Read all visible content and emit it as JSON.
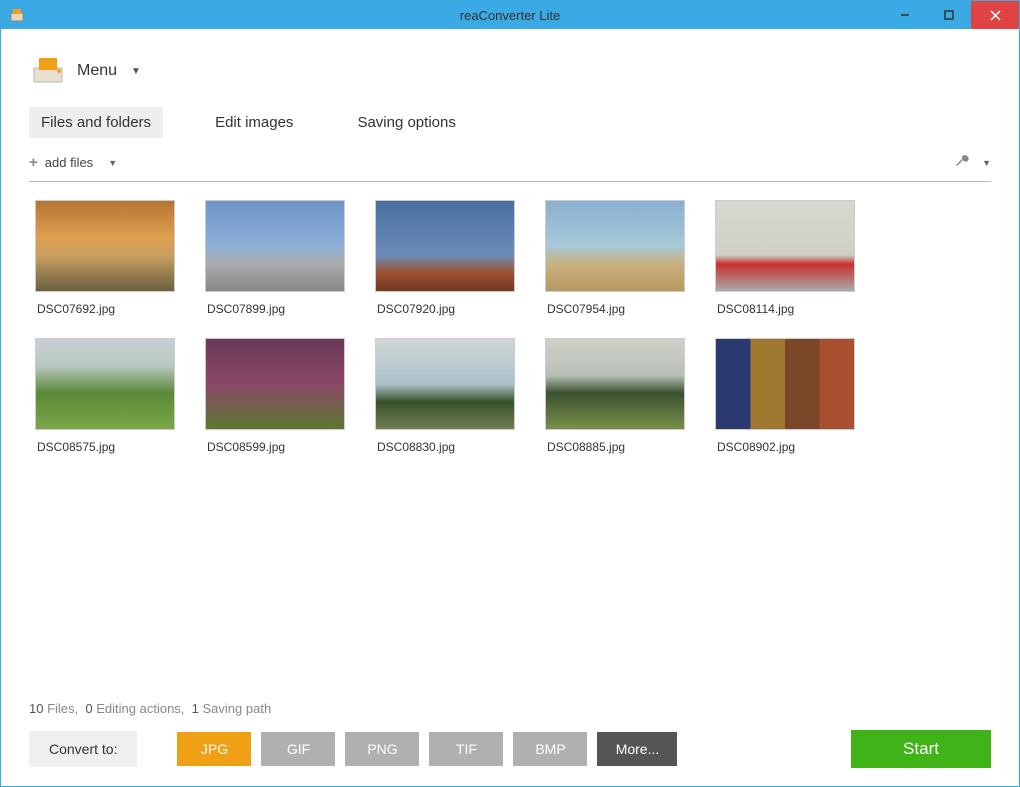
{
  "window": {
    "title": "reaConverter Lite"
  },
  "menu": {
    "label": "Menu"
  },
  "tabs": [
    {
      "label": "Files and folders",
      "active": true
    },
    {
      "label": "Edit images",
      "active": false
    },
    {
      "label": "Saving options",
      "active": false
    }
  ],
  "toolbar": {
    "add_files": "add files"
  },
  "thumbnails": [
    {
      "name": "DSC07692.jpg",
      "cls": "g-sunset"
    },
    {
      "name": "DSC07899.jpg",
      "cls": "g-tower"
    },
    {
      "name": "DSC07920.jpg",
      "cls": "g-skull"
    },
    {
      "name": "DSC07954.jpg",
      "cls": "g-beach"
    },
    {
      "name": "DSC08114.jpg",
      "cls": "g-mailbox"
    },
    {
      "name": "DSC08575.jpg",
      "cls": "g-field"
    },
    {
      "name": "DSC08599.jpg",
      "cls": "g-onion"
    },
    {
      "name": "DSC08830.jpg",
      "cls": "g-tree"
    },
    {
      "name": "DSC08885.jpg",
      "cls": "g-shore"
    },
    {
      "name": "DSC08902.jpg",
      "cls": "g-fabric"
    }
  ],
  "status": {
    "files_count": "10",
    "files_label": "Files,",
    "editing_count": "0",
    "editing_label": "Editing actions,",
    "saving_count": "1",
    "saving_label": "Saving path"
  },
  "bottom": {
    "convert_label": "Convert to:",
    "formats": [
      {
        "label": "JPG",
        "active": true
      },
      {
        "label": "GIF",
        "active": false
      },
      {
        "label": "PNG",
        "active": false
      },
      {
        "label": "TIF",
        "active": false
      },
      {
        "label": "BMP",
        "active": false
      }
    ],
    "more": "More...",
    "start": "Start"
  }
}
